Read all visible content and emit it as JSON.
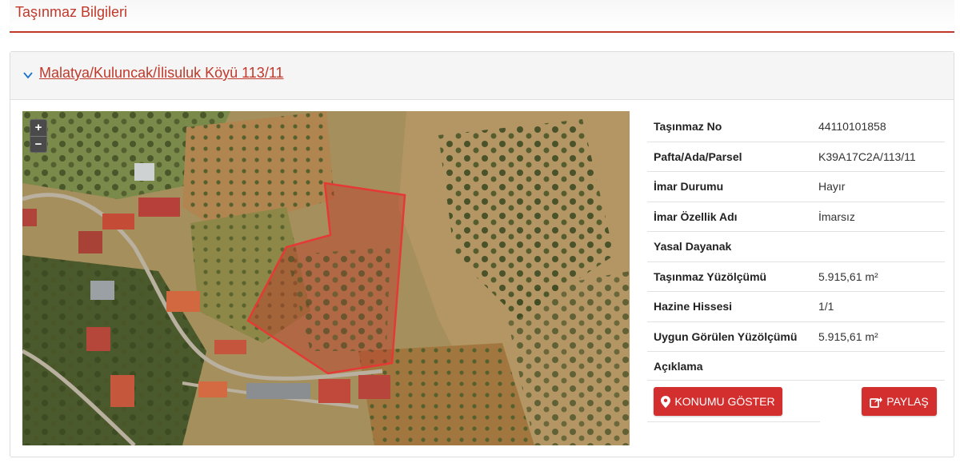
{
  "page": {
    "title": "Taşınmaz Bilgileri"
  },
  "panel": {
    "heading": "Malatya/Kuluncak/İlisuluk Köyü 113/11",
    "chevron_icon": "chevron-down-icon"
  },
  "map": {
    "zoom_in": "+",
    "zoom_out": "−",
    "parcel_outline_color": "#e53935"
  },
  "info": {
    "rows": [
      {
        "label": "Taşınmaz No",
        "value": "44110101858"
      },
      {
        "label": "Pafta/Ada/Parsel",
        "value": "K39A17C2A/113/11"
      },
      {
        "label": "İmar Durumu",
        "value": "Hayır"
      },
      {
        "label": "İmar Özellik Adı",
        "value": "İmarsız"
      },
      {
        "label": "Yasal Dayanak",
        "value": ""
      },
      {
        "label": "Taşınmaz Yüzölçümü",
        "value": "5.915,61 m²"
      },
      {
        "label": "Hazine Hissesi",
        "value": "1/1"
      },
      {
        "label": "Uygun Görülen Yüzölçümü",
        "value": "5.915,61 m²"
      },
      {
        "label": "Açıklama",
        "value": ""
      }
    ]
  },
  "actions": {
    "show_location": "KONUMU GÖSTER",
    "show_location_icon": "map-marker-icon",
    "share": "PAYLAŞ",
    "share_icon": "share-icon"
  },
  "colors": {
    "accent": "#c0392b",
    "button": "#d32f2f"
  }
}
